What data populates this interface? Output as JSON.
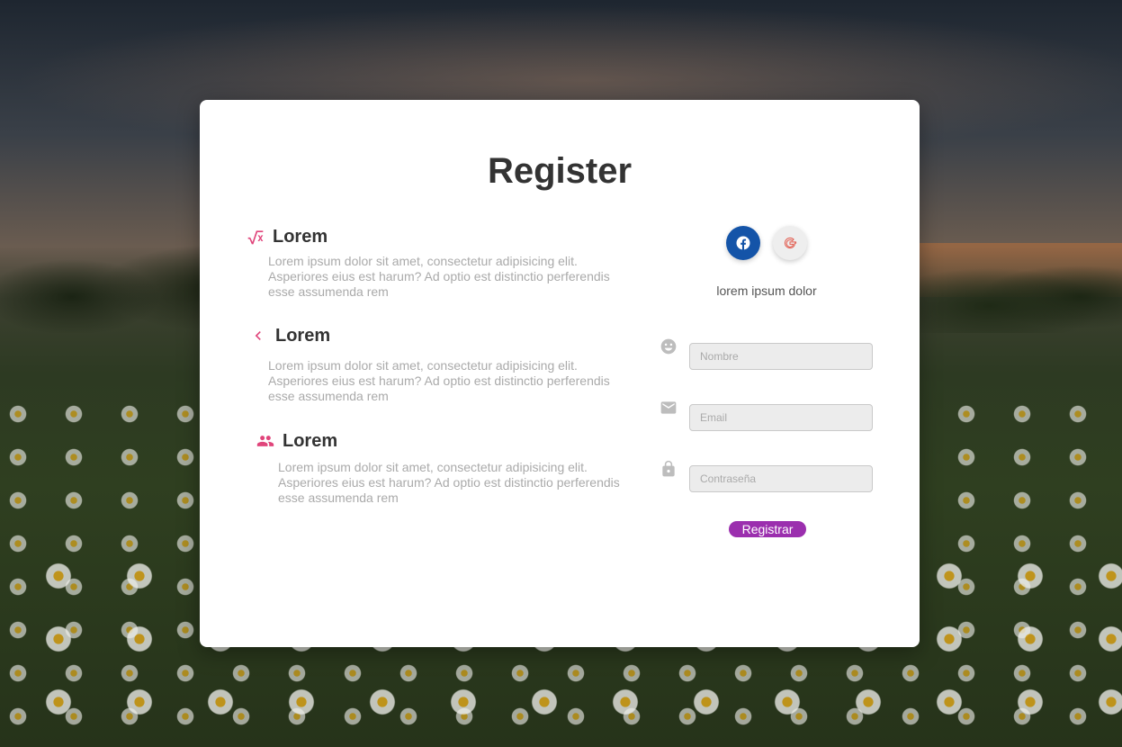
{
  "page": {
    "title": "Register",
    "colors": {
      "accent": "#e0457b",
      "button": "#9b2fae",
      "facebook": "#1454a8"
    }
  },
  "features": [
    {
      "icon": "square-root-icon",
      "title": "Lorem",
      "text": "Lorem ipsum dolor sit amet, consectetur adipisicing elit. Asperiores eius est harum? Ad optio est distinctio perferendis esse assumenda rem"
    },
    {
      "icon": "chevron-left-icon",
      "title": "Lorem",
      "text": "Lorem ipsum dolor sit amet, consectetur adipisicing elit. Asperiores eius est harum? Ad optio est distinctio perferendis esse assumenda rem"
    },
    {
      "icon": "people-icon",
      "title": "Lorem",
      "text": "Lorem ipsum dolor sit amet, consectetur adipisicing elit. Asperiores eius est harum? Ad optio est distinctio perferendis esse assumenda rem"
    }
  ],
  "social": {
    "tagline": "lorem ipsum dolor"
  },
  "form": {
    "name": {
      "placeholder": "Nombre",
      "value": ""
    },
    "email": {
      "placeholder": "Email",
      "value": ""
    },
    "password": {
      "placeholder": "Contraseña",
      "value": ""
    },
    "submit_label": "Registrar"
  }
}
